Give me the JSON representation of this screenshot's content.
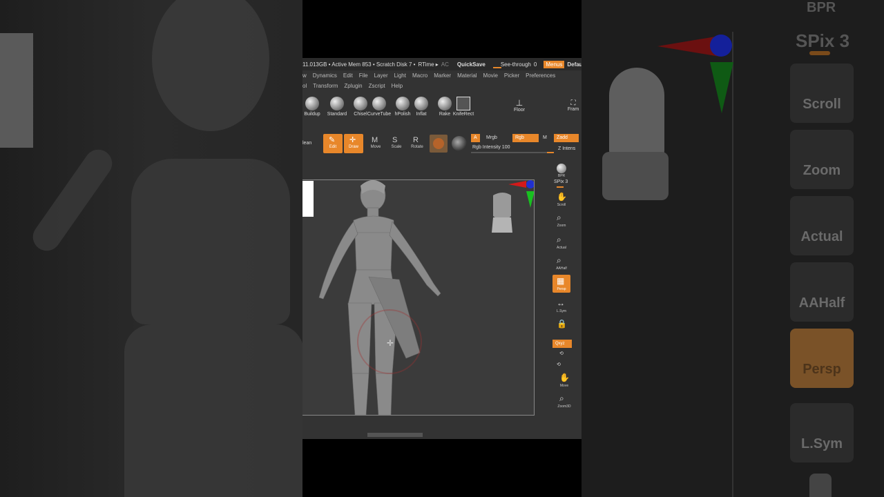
{
  "status": {
    "mem_info": "11.013GB • Active Mem 853 • Scratch Disk 7 •",
    "rtime": "RTime ▸",
    "ac": "AC",
    "quicksave": "QuickSave",
    "see_through": "See-through",
    "see_through_value": "0",
    "menus": "Menus",
    "default": "DefaultZ"
  },
  "menu_row1": [
    "w",
    "Dynamics",
    "Edit",
    "File",
    "Layer",
    "Light",
    "Macro",
    "Marker",
    "Material",
    "Movie",
    "Picker",
    "Preferences"
  ],
  "menu_row2": [
    "ol",
    "Transform",
    "Zplugin",
    "Zscript",
    "Help"
  ],
  "brushes": [
    "Buildup",
    "Standard",
    "Chisel",
    "CurveTube",
    "hPolish",
    "Inflat",
    "Rake",
    "KnifeRect"
  ],
  "floor_label": "Floor",
  "frame_label": "Fram",
  "tools": {
    "clean": "lean",
    "edit": "Edit",
    "draw": "Draw",
    "move": "Move",
    "scale": "Scale",
    "rotate": "Rotate",
    "a": "A",
    "mrgb": "Mrgb",
    "rgb": "Rgb",
    "m": "M",
    "zadd": "Zadd",
    "rgb_intensity": "Rgb Intensity 100",
    "z_intensity": "Z Intens"
  },
  "shelf": {
    "bpr": "BPR",
    "spix": "SPix 3",
    "scroll": "Scroll",
    "zoom": "Zoom",
    "actual": "Actual",
    "aahalf": "AAHalf",
    "persp": "Persp",
    "lsym": "L.Sym",
    "xyz": "Qxyz",
    "move": "Move",
    "zoom3d": "Zoom3D"
  },
  "side_right": {
    "bpr": "BPR",
    "spix": "SPix 3",
    "scroll": "Scroll",
    "zoom": "Zoom",
    "actual": "Actual",
    "aahalf": "AAHalf",
    "persp": "Persp",
    "lsym": "L.Sym"
  },
  "colors": {
    "accent": "#e8872a",
    "panel": "#333333",
    "canvas": "#3b3b3b"
  }
}
